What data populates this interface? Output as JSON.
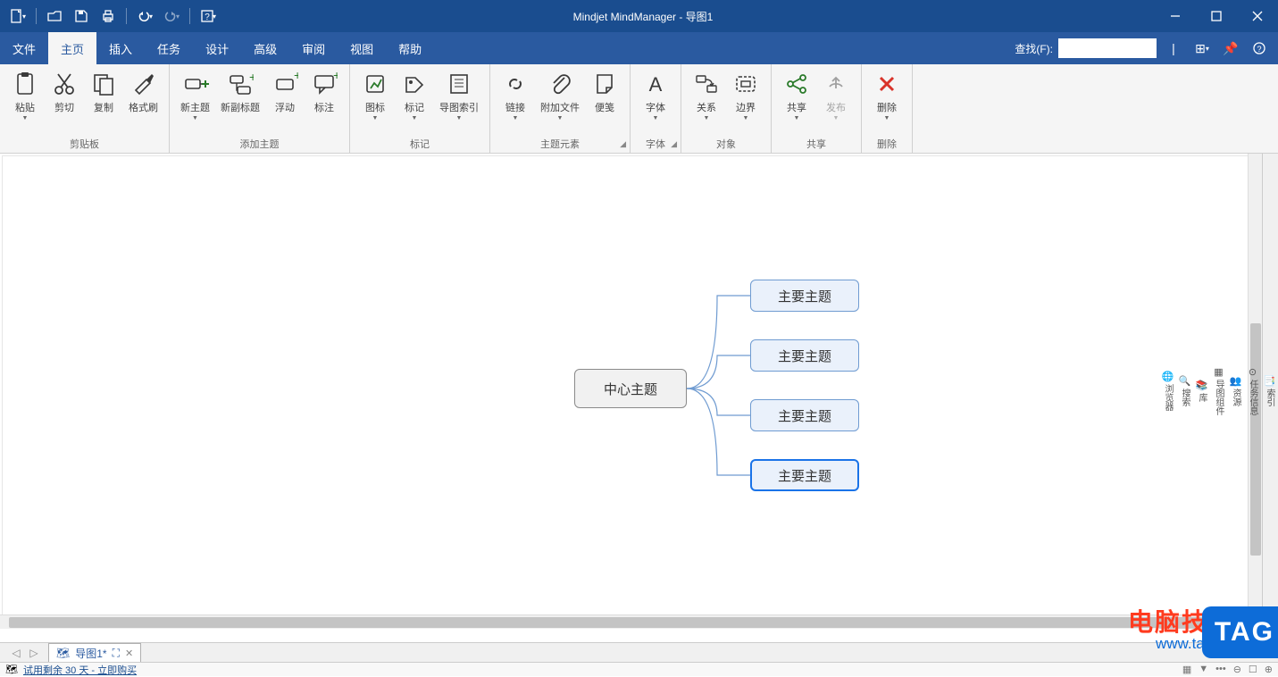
{
  "window": {
    "title": "Mindjet MindManager - 导图1"
  },
  "qat": {
    "new": "新建",
    "open": "打开",
    "save": "保存",
    "print": "打印",
    "undo": "撤销",
    "redo": "重做",
    "help": "帮助"
  },
  "menu": {
    "items": [
      "文件",
      "主页",
      "插入",
      "任务",
      "设计",
      "高级",
      "审阅",
      "视图",
      "帮助"
    ],
    "active_index": 1,
    "search_label": "查找(F):",
    "search_value": ""
  },
  "ribbon": {
    "groups": [
      {
        "label": "剪贴板",
        "expand": false,
        "buttons": [
          {
            "label": "粘贴",
            "dd": true,
            "icon": "paste"
          },
          {
            "label": "剪切",
            "dd": false,
            "icon": "cut"
          },
          {
            "label": "复制",
            "dd": false,
            "icon": "copy"
          },
          {
            "label": "格式刷",
            "dd": false,
            "icon": "brush"
          }
        ]
      },
      {
        "label": "添加主题",
        "expand": false,
        "buttons": [
          {
            "label": "新主题",
            "dd": true,
            "icon": "newtopic"
          },
          {
            "label": "新副标题",
            "dd": false,
            "icon": "subtopic"
          },
          {
            "label": "浮动",
            "dd": false,
            "icon": "float"
          },
          {
            "label": "标注",
            "dd": false,
            "icon": "callout"
          }
        ]
      },
      {
        "label": "标记",
        "expand": false,
        "buttons": [
          {
            "label": "图标",
            "dd": true,
            "icon": "icons"
          },
          {
            "label": "标记",
            "dd": true,
            "icon": "tag"
          },
          {
            "label": "导图索引",
            "dd": true,
            "icon": "index"
          }
        ]
      },
      {
        "label": "主题元素",
        "expand": true,
        "buttons": [
          {
            "label": "链接",
            "dd": true,
            "icon": "link"
          },
          {
            "label": "附加文件",
            "dd": true,
            "icon": "attach"
          },
          {
            "label": "便笺",
            "dd": false,
            "icon": "note"
          }
        ]
      },
      {
        "label": "字体",
        "expand": true,
        "buttons": [
          {
            "label": "字体",
            "dd": true,
            "icon": "font"
          }
        ]
      },
      {
        "label": "对象",
        "expand": false,
        "buttons": [
          {
            "label": "关系",
            "dd": true,
            "icon": "relation"
          },
          {
            "label": "边界",
            "dd": true,
            "icon": "boundary"
          }
        ]
      },
      {
        "label": "共享",
        "expand": false,
        "buttons": [
          {
            "label": "共享",
            "dd": true,
            "icon": "share"
          },
          {
            "label": "发布",
            "dd": true,
            "icon": "publish",
            "disabled": true
          }
        ]
      },
      {
        "label": "删除",
        "expand": false,
        "buttons": [
          {
            "label": "删除",
            "dd": true,
            "icon": "delete"
          }
        ]
      }
    ]
  },
  "mindmap": {
    "central": "中心主题",
    "branches": [
      "主要主题",
      "主要主题",
      "主要主题",
      "主要主题"
    ],
    "selected_index": 3
  },
  "right_panel": [
    "索引",
    "任务信息",
    "资源",
    "导图组件",
    "库",
    "搜索",
    "浏览器"
  ],
  "doc_tabs": {
    "tab1": "导图1*",
    "expand": "⛶",
    "close": "✕"
  },
  "status": {
    "trial": "试用剩余 30 天 - 立即购买"
  },
  "watermark": {
    "line1": "电脑技术网",
    "line2": "www.tagxp.com",
    "tag": "TAG"
  }
}
